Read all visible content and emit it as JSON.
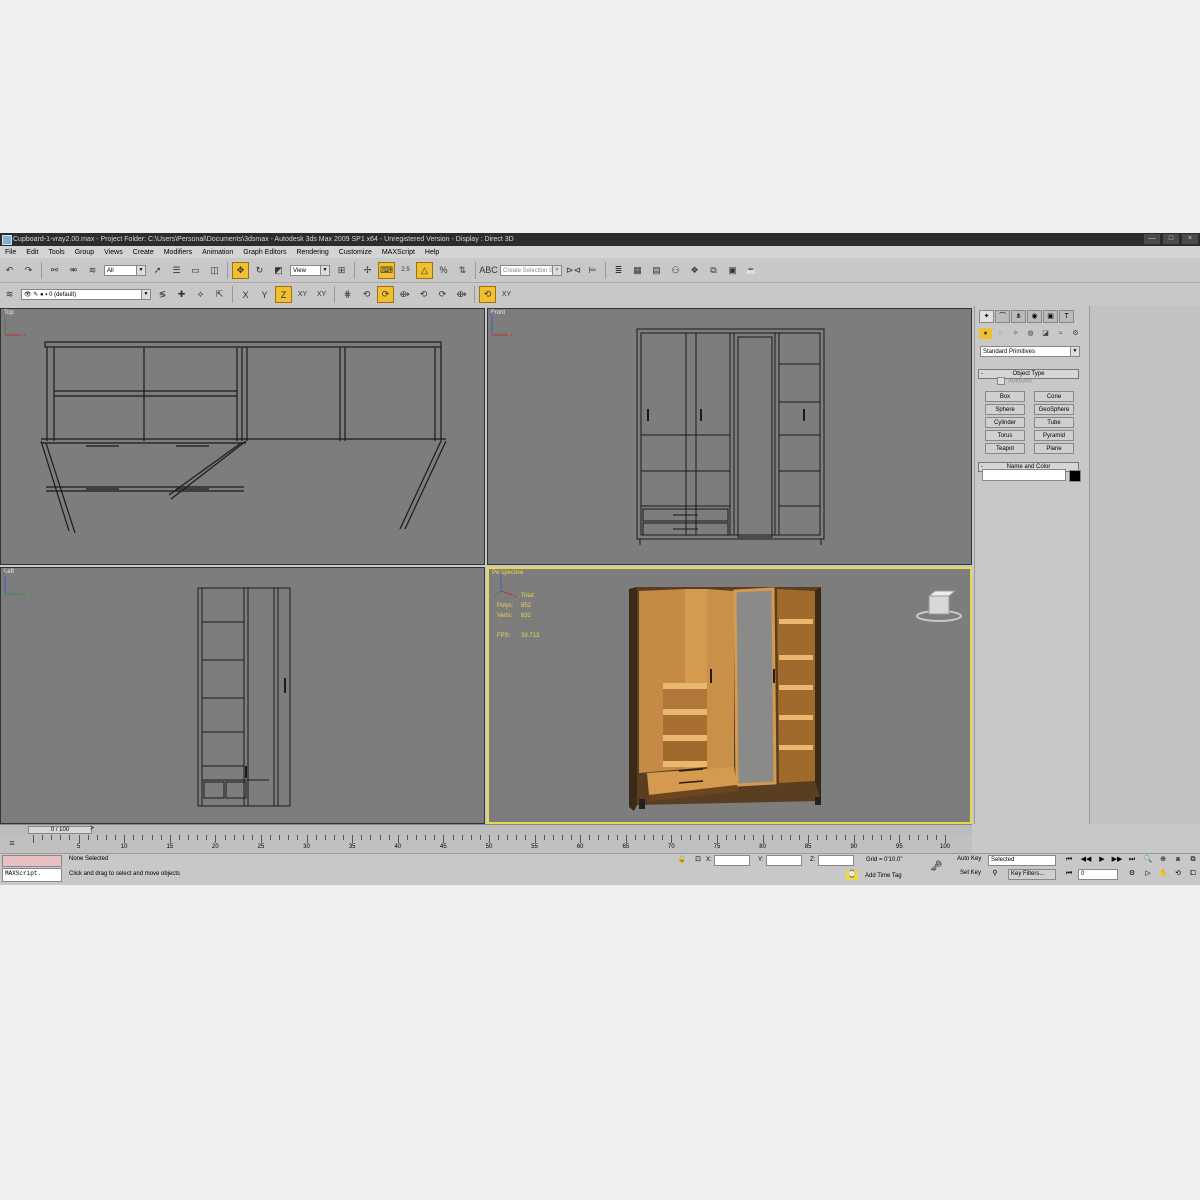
{
  "window": {
    "title": "Cupboard-1-vray2.00.max    - Project Folder: C:\\Users\\Personal\\Documents\\3dsmax    - Autodesk 3ds Max  2009 SP1  x64  - Unregistered Version     - Display : Direct 3D",
    "min": "—",
    "max": "□",
    "close": "×"
  },
  "menu": [
    "File",
    "Edit",
    "Tools",
    "Group",
    "Views",
    "Create",
    "Modifiers",
    "Animation",
    "Graph Editors",
    "Rendering",
    "Customize",
    "MAXScript",
    "Help"
  ],
  "toolbar": {
    "filter_value": "All",
    "refcoord_value": "View",
    "named_selection_placeholder": "Create Selection Set",
    "snap_label": "2.5",
    "layer_value": "0 (default)",
    "axis_x": "X",
    "axis_y": "Y",
    "axis_z": "Z",
    "axis_xy": "XY",
    "axis_xy2": "XY",
    "axis_xy3": "XY"
  },
  "viewports": {
    "top": {
      "label": "Top"
    },
    "front": {
      "label": "Front"
    },
    "left": {
      "label": "Left"
    },
    "perspective": {
      "label": "Perspective",
      "stats_total": "Total",
      "polys_label": "Polys:",
      "polys_value": "852",
      "verts_label": "Verts:",
      "verts_value": "832",
      "fps_label": "FPS:",
      "fps_value": "39.713"
    }
  },
  "command_panel": {
    "category": "Standard Primitives",
    "object_type_title": "Object Type",
    "autogrid_label": "AutoGrid",
    "buttons": [
      "Box",
      "Cone",
      "Sphere",
      "GeoSphere",
      "Cylinder",
      "Tube",
      "Torus",
      "Pyramid",
      "Teapot",
      "Plane"
    ],
    "name_color_title": "Name and Color",
    "object_color": "#000000"
  },
  "timeline": {
    "slider_label": "0 / 100",
    "ticks": [
      "5",
      "10",
      "15",
      "20",
      "25",
      "30",
      "35",
      "40",
      "45",
      "50",
      "55",
      "60",
      "65",
      "70",
      "75",
      "80",
      "85",
      "90",
      "95",
      "100"
    ]
  },
  "status": {
    "maxscript_label": "MAXScript.",
    "selection": "None Selected",
    "prompt": "Click and drag to select and move objects",
    "x_label": "X:",
    "y_label": "Y:",
    "z_label": "Z:",
    "grid": "Grid = 0'10.0\"",
    "add_time_tag": "Add Time Tag",
    "auto_key": "Auto Key",
    "set_key": "Set Key",
    "key_mode": "Selected",
    "key_filters": "Key Filters...",
    "frame": "0"
  },
  "colors": {
    "active_viewport_border": "#e8d84a",
    "wood": "#d49a50",
    "viewport_bg": "#7d7d7d"
  }
}
